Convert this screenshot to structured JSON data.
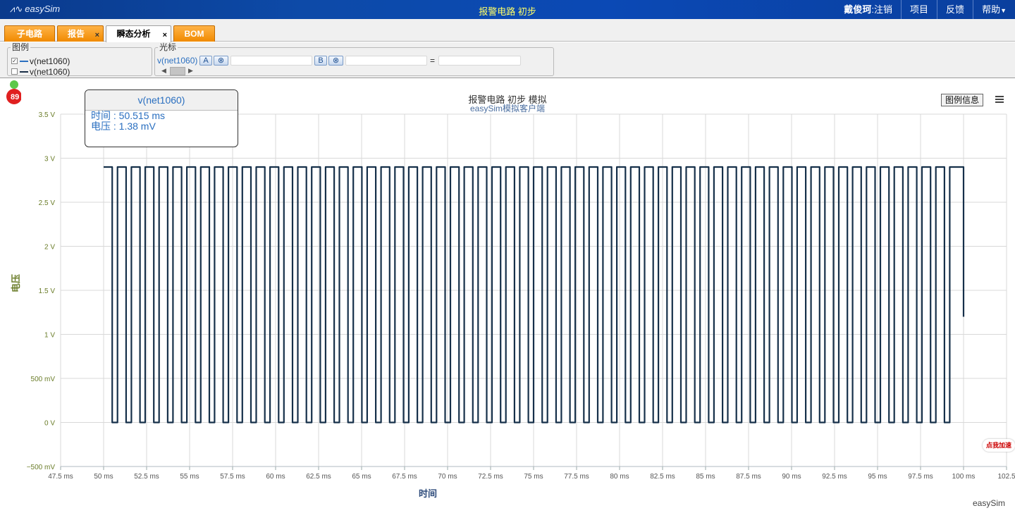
{
  "header": {
    "logo": "easySim",
    "title": "报警电路 初步",
    "user_name": "戴俊珂",
    "logout_label": ":注销",
    "nav": [
      "项目",
      "反馈",
      "帮助"
    ]
  },
  "tabs": [
    {
      "label": "子电路",
      "closable": false,
      "active": false
    },
    {
      "label": "报告",
      "closable": true,
      "active": false
    },
    {
      "label": "瞬态分析",
      "closable": true,
      "active": true
    },
    {
      "label": "BOM",
      "closable": false,
      "active": false
    }
  ],
  "tab_close_glyph": "×",
  "legend_panel": {
    "title": "图例",
    "items": [
      {
        "label": "v(net1060)",
        "checked": true,
        "color": "#2a6fc0"
      },
      {
        "label": "v(net1060)",
        "checked": false,
        "color": "#1a2f48"
      }
    ]
  },
  "cursor_panel": {
    "title": "光标",
    "trace": "v(net1060)",
    "btn_a": "A",
    "btn_b": "B",
    "clear_glyph": "⊗",
    "equals": "=",
    "value_a": "",
    "value_b": "",
    "diff": ""
  },
  "chart_header": {
    "legend_info_button": "图例信息"
  },
  "tooltip": {
    "title": "v(net1060)",
    "time": "时间 : 50.515 ms",
    "voltage": "电压 : 1.38 mV"
  },
  "chart_data": {
    "type": "line",
    "title": "报警电路 初步 模拟",
    "subtitle": "easySim模拟客户端",
    "xlabel": "时间",
    "ylabel": "电压",
    "x_unit": "ms",
    "xlim": [
      47.5,
      102.5
    ],
    "ylim": [
      -0.5,
      3.5
    ],
    "x_ticks": [
      "47.5 ms",
      "50 ms",
      "52.5 ms",
      "55 ms",
      "57.5 ms",
      "60 ms",
      "62.5 ms",
      "65 ms",
      "67.5 ms",
      "70 ms",
      "72.5 ms",
      "75 ms",
      "77.5 ms",
      "80 ms",
      "82.5 ms",
      "85 ms",
      "87.5 ms",
      "90 ms",
      "92.5 ms",
      "95 ms",
      "97.5 ms",
      "100 ms",
      "102.5"
    ],
    "y_ticks": [
      "3.5 V",
      "3 V",
      "2.5 V",
      "2 V",
      "1.5 V",
      "1 V",
      "500 mV",
      "0 V",
      "−500 mV"
    ],
    "grid": true,
    "series": [
      {
        "color": "#16304a",
        "signal": "square",
        "x_start": 50.0,
        "x_end": 100.0,
        "period_ms": 0.8065,
        "duty": 0.62,
        "high": 2.9,
        "low": 0.0,
        "end_value": 1.2
      }
    ]
  },
  "footer": {
    "brand": "easySim",
    "speed_badge": "点我加速",
    "speed_value": "89"
  }
}
